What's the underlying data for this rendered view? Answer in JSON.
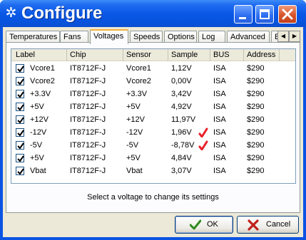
{
  "window": {
    "title": "Configure",
    "icon": "fan-icon"
  },
  "tabs": [
    {
      "label": "Temperatures",
      "active": false
    },
    {
      "label": "Fans",
      "active": false
    },
    {
      "label": "Voltages",
      "active": true
    },
    {
      "label": "Speeds",
      "active": false
    },
    {
      "label": "Options",
      "active": false
    },
    {
      "label": "Log",
      "active": false
    },
    {
      "label": "Advanced",
      "active": false
    },
    {
      "label": "E",
      "active": false
    }
  ],
  "table": {
    "columns": [
      "Label",
      "Chip",
      "Sensor",
      "Sample",
      "BUS",
      "Address"
    ],
    "rows": [
      {
        "checked": true,
        "label": "Vcore1",
        "chip": "IT8712F-J",
        "sensor": "Vcore1",
        "sample": "1,12V",
        "bus": "ISA",
        "address": "$290",
        "marked": false
      },
      {
        "checked": true,
        "label": "Vcore2",
        "chip": "IT8712F-J",
        "sensor": "Vcore2",
        "sample": "0,00V",
        "bus": "ISA",
        "address": "$290",
        "marked": false
      },
      {
        "checked": true,
        "label": "+3.3V",
        "chip": "IT8712F-J",
        "sensor": "+3.3V",
        "sample": "3,42V",
        "bus": "ISA",
        "address": "$290",
        "marked": false
      },
      {
        "checked": true,
        "label": "+5V",
        "chip": "IT8712F-J",
        "sensor": "+5V",
        "sample": "4,92V",
        "bus": "ISA",
        "address": "$290",
        "marked": false
      },
      {
        "checked": true,
        "label": "+12V",
        "chip": "IT8712F-J",
        "sensor": "+12V",
        "sample": "11,97V",
        "bus": "ISA",
        "address": "$290",
        "marked": false
      },
      {
        "checked": true,
        "label": "-12V",
        "chip": "IT8712F-J",
        "sensor": "-12V",
        "sample": "1,96V",
        "bus": "ISA",
        "address": "$290",
        "marked": true
      },
      {
        "checked": true,
        "label": "-5V",
        "chip": "IT8712F-J",
        "sensor": "-5V",
        "sample": "-8,78V",
        "bus": "ISA",
        "address": "$290",
        "marked": true
      },
      {
        "checked": true,
        "label": "+5V",
        "chip": "IT8712F-J",
        "sensor": "+5V",
        "sample": "4,84V",
        "bus": "ISA",
        "address": "$290",
        "marked": false
      },
      {
        "checked": true,
        "label": "Vbat",
        "chip": "IT8712F-J",
        "sensor": "Vbat",
        "sample": "3,07V",
        "bus": "ISA",
        "address": "$290",
        "marked": false
      }
    ]
  },
  "hint": "Select a voltage to change its settings",
  "buttons": {
    "ok": "OK",
    "cancel": "Cancel"
  },
  "colors": {
    "titlebar": "#0a58e6",
    "mark": "#e8202a",
    "ok_icon": "#2e8b1e",
    "cancel_icon": "#c0201a"
  }
}
